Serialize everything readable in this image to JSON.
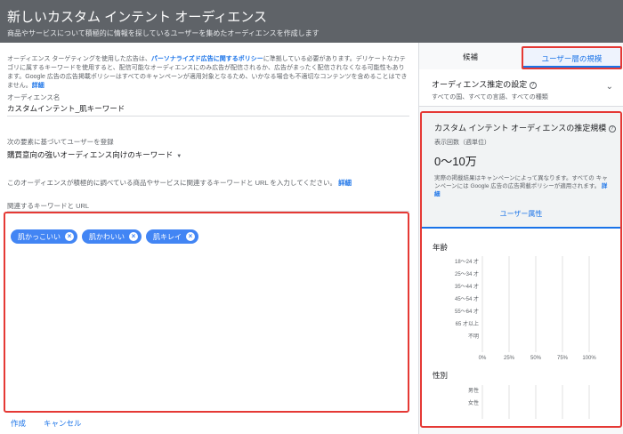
{
  "header": {
    "title": "新しいカスタム インテント オーディエンス",
    "subtitle": "商品やサービスについて積極的に情報を探しているユーザーを集めたオーディエンスを作成します"
  },
  "form": {
    "description_pre": "オーディエンス ターゲティングを使用した広告は、",
    "description_link": "パーソナライズド広告に関するポリシー",
    "description_post": "に準拠している必要があります。デリケートなカテゴリに属するキーワードを使用すると、配信可能なオーディエンスにのみ広告が配信されるか、広告がまったく配信されなくなる可能性もあります。Google 広告の広告掲載ポリシーはすべてのキャンペーンが適用対象となるため、いかなる場合も不適切なコンテンツを含めることはできません。",
    "description_details": "詳細",
    "audience_name_label": "オーディエンス名",
    "audience_name_value": "カスタムインテント_肌キーワード",
    "targeting_label": "次の要素に基づいてユーザーを登録",
    "targeting_value": "購買意向の強いオーディエンス向けのキーワード",
    "help_text": "このオーディエンスが積極的に調べている商品やサービスに関連するキーワードと URL を入力してください。",
    "help_details": "詳細",
    "keywords_label": "関連するキーワードと URL",
    "keywords": [
      "肌かっこいい",
      "肌かわいい",
      "肌キレイ"
    ],
    "create_label": "作成",
    "cancel_label": "キャンセル"
  },
  "sidebar": {
    "tab_candidates": "候補",
    "tab_users": "ユーザー層の規模",
    "estimate_title": "オーディエンス推定の設定",
    "estimate_sub": "すべての国、すべての言語、すべての種類",
    "summary_title": "カスタム インテント オーディエンスの推定規模",
    "summary_sub": "表示回数（週単位）",
    "summary_value": "0〜10万",
    "summary_note": "実際の掲載結果はキャンペーンによって異なります。すべての キャンペーンには Google 広告の広告掲載ポリシーが適用されます。",
    "summary_details": "詳細",
    "user_attr_label": "ユーザー属性",
    "age_title": "年齢",
    "gender_title": "性別",
    "accent_color": "#1a73e8",
    "alert_color": "#e53935"
  },
  "chart_data": [
    {
      "type": "bar",
      "title": "年齢",
      "categories": [
        "18〜24 才",
        "25〜34 才",
        "35〜44 才",
        "45〜54 才",
        "55〜64 才",
        "65 才以上",
        "不明"
      ],
      "values": [
        0,
        0,
        0,
        0,
        0,
        0,
        0
      ],
      "x_ticks": [
        "0%",
        "25%",
        "50%",
        "75%",
        "100%"
      ],
      "xlim": [
        0,
        100
      ],
      "grid": true
    },
    {
      "type": "bar",
      "title": "性別",
      "categories": [
        "男性",
        "女性"
      ],
      "values": [
        0,
        0
      ],
      "xlim": [
        0,
        100
      ],
      "grid": true
    }
  ]
}
